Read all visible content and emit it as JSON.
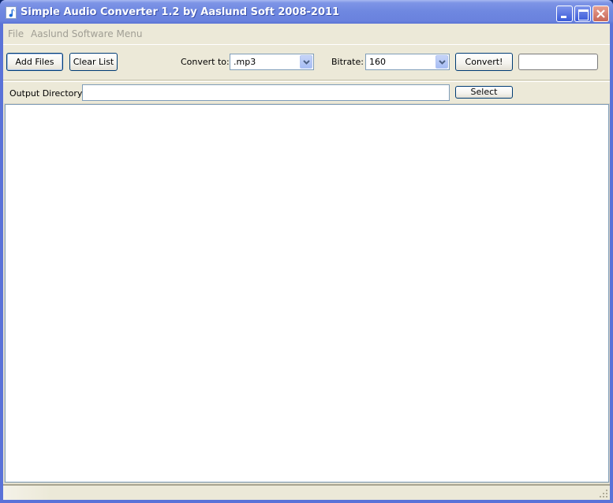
{
  "window": {
    "title": "Simple Audio Converter 1.2 by Aaslund Soft 2008-2011",
    "icon": "music-note-icon",
    "controls": {
      "minimize": "minimize-icon",
      "maximize": "maximize-icon",
      "close": "close-icon"
    }
  },
  "menubar": {
    "items": [
      {
        "label": "File"
      },
      {
        "label": "Aaslund Software Menu"
      }
    ]
  },
  "toolbar": {
    "add_files_label": "Add Files",
    "clear_list_label": "Clear List",
    "convert_to_label": "Convert to:",
    "convert_to_value": ".mp3",
    "bitrate_label": "Bitrate:",
    "bitrate_value": "160",
    "convert_label": "Convert!",
    "progress_value": ""
  },
  "output": {
    "label": "Output Directory:",
    "value": "",
    "select_label": "Select"
  },
  "file_list": {
    "items": []
  },
  "colors": {
    "titlebar": "#6e87e0",
    "face": "#ece9d8",
    "button_border": "#003c74",
    "input_border": "#7f9db9"
  }
}
